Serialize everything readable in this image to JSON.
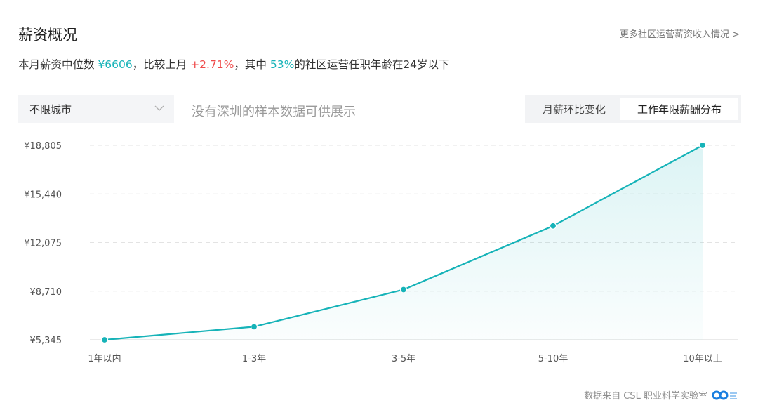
{
  "header": {
    "title": "薪资概况",
    "more_link": "更多社区运营薪资收入情况 >"
  },
  "summary": {
    "prefix": "本月薪资中位数 ",
    "median": "¥6606",
    "compare_text": "，比较上月 ",
    "change": "+2.71%",
    "middle_text": "，其中 ",
    "percent": "53%",
    "suffix": "的社区运营任职年龄在24岁以下"
  },
  "filter": {
    "city_label": "不限城市",
    "no_data": "没有深圳的样本数据可供展示"
  },
  "toggle": {
    "option1": "月薪环比变化",
    "option2": "工作年限薪酬分布"
  },
  "footer": {
    "source": "数据来自 CSL 职业科学实验室"
  },
  "colors": {
    "accent": "#16b3b8",
    "positive_change": "#ef4a4a"
  },
  "chart_data": {
    "type": "area",
    "categories": [
      "1年以内",
      "1-3年",
      "3-5年",
      "5-10年",
      "10年以上"
    ],
    "values": [
      5345,
      6250,
      8820,
      13230,
      18805
    ],
    "y_ticks": [
      "¥5,345",
      "¥8,710",
      "¥12,075",
      "¥15,440",
      "¥18,805"
    ],
    "ylim": [
      5345,
      18805
    ],
    "grid": true
  }
}
